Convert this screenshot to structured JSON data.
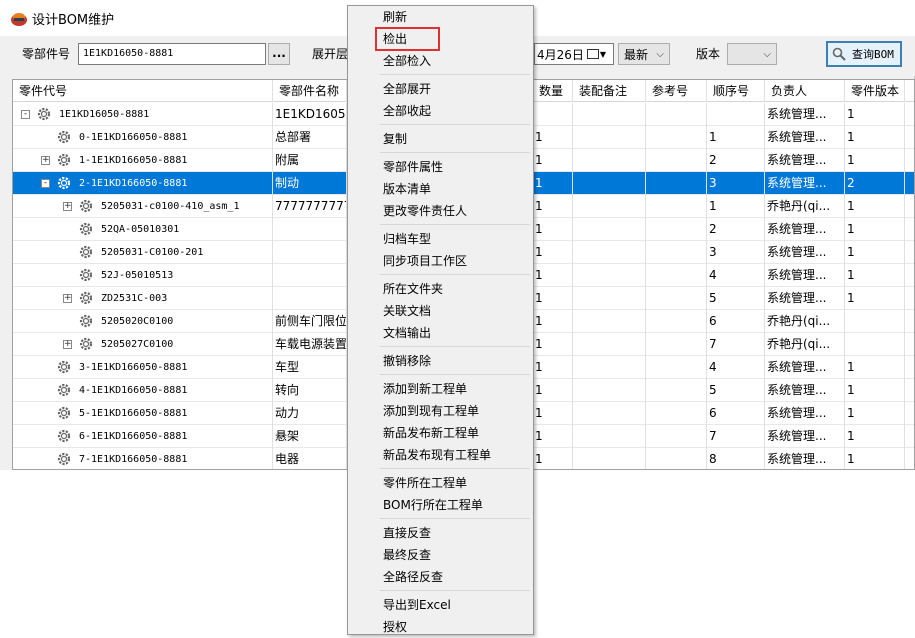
{
  "window": {
    "title": "设计BOM维护"
  },
  "toolbar": {
    "part_no_label": "零部件号",
    "part_no_value": "1E1KD16050-8881",
    "dots_label": "...",
    "expand_label": "展开层",
    "date_value": "4月26日",
    "latest_value": "最新",
    "version_label": "版本",
    "version_value": "",
    "query_label": "查询BOM"
  },
  "grid": {
    "columns": [
      "零件代号",
      "零部件名称",
      "数量",
      "装配备注",
      "参考号",
      "顺序号",
      "负责人",
      "零件版本"
    ],
    "rows": [
      {
        "code": "1E1KD16050-8881",
        "name": "1E1KD16050-6",
        "qty": "",
        "seq": "",
        "owner": "系统管理...",
        "ver": "1",
        "level": 0,
        "expander": "⊟"
      },
      {
        "code": "0-1E1KD166050-8881",
        "name": "总部署",
        "qty": "1",
        "seq": "1",
        "owner": "系统管理...",
        "ver": "1",
        "level": 1,
        "expander": ""
      },
      {
        "code": "1-1E1KD166050-8881",
        "name": "附属",
        "qty": "1",
        "seq": "2",
        "owner": "系统管理...",
        "ver": "1",
        "level": 1,
        "expander": "+"
      },
      {
        "code": "2-1E1KD166050-8881",
        "name": "制动",
        "qty": "1",
        "seq": "3",
        "owner": "系统管理...",
        "ver": "2",
        "level": 1,
        "expander": "-"
      },
      {
        "code": "5205031-c0100-410_asm_1",
        "name": "7777777777",
        "qty": "1",
        "seq": "1",
        "owner": "乔艳丹(qi...",
        "ver": "1",
        "level": 2,
        "expander": "+"
      },
      {
        "code": "52QA-05010301",
        "name": "",
        "qty": "1",
        "seq": "2",
        "owner": "系统管理...",
        "ver": "1",
        "level": 2,
        "expander": ""
      },
      {
        "code": "5205031-C0100-201",
        "name": "",
        "qty": "1",
        "seq": "3",
        "owner": "系统管理...",
        "ver": "1",
        "level": 2,
        "expander": ""
      },
      {
        "code": "52J-05010513",
        "name": "",
        "qty": "1",
        "seq": "4",
        "owner": "系统管理...",
        "ver": "1",
        "level": 2,
        "expander": ""
      },
      {
        "code": "ZD2531C-003",
        "name": "",
        "qty": "1",
        "seq": "5",
        "owner": "系统管理...",
        "ver": "1",
        "level": 2,
        "expander": "+"
      },
      {
        "code": "5205020C0100",
        "name": "前侧车门限位",
        "qty": "1",
        "seq": "6",
        "owner": "乔艳丹(qi...",
        "ver": "",
        "level": 2,
        "expander": ""
      },
      {
        "code": "5205027C0100",
        "name": "车载电源装置",
        "qty": "1",
        "seq": "7",
        "owner": "乔艳丹(qi...",
        "ver": "",
        "level": 2,
        "expander": "+"
      },
      {
        "code": "3-1E1KD166050-8881",
        "name": "车型",
        "qty": "1",
        "seq": "4",
        "owner": "系统管理...",
        "ver": "1",
        "level": 1,
        "expander": ""
      },
      {
        "code": "4-1E1KD166050-8881",
        "name": "转向",
        "qty": "1",
        "seq": "5",
        "owner": "系统管理...",
        "ver": "1",
        "level": 1,
        "expander": ""
      },
      {
        "code": "5-1E1KD166050-8881",
        "name": "动力",
        "qty": "1",
        "seq": "6",
        "owner": "系统管理...",
        "ver": "1",
        "level": 1,
        "expander": ""
      },
      {
        "code": "6-1E1KD166050-8881",
        "name": "悬架",
        "qty": "1",
        "seq": "7",
        "owner": "系统管理...",
        "ver": "1",
        "level": 1,
        "expander": ""
      },
      {
        "code": "7-1E1KD166050-8881",
        "name": "电器",
        "qty": "1",
        "seq": "8",
        "owner": "系统管理...",
        "ver": "1",
        "level": 1,
        "expander": ""
      }
    ]
  },
  "context_menu": {
    "items": [
      "刷新",
      "检出",
      "全部检入",
      "全部展开",
      "全部收起",
      "复制",
      "零部件属性",
      "版本清单",
      "更改零件责任人",
      "归档车型",
      "同步项目工作区",
      "所在文件夹",
      "关联文档",
      "文档输出",
      "撤销移除",
      "添加到新工程单",
      "添加到现有工程单",
      "新品发布新工程单",
      "新品发布现有工程单",
      "零件所在工程单",
      "BOM行所在工程单",
      "直接反查",
      "最终反查",
      "全路径反查",
      "导出到Excel",
      "授权"
    ]
  }
}
